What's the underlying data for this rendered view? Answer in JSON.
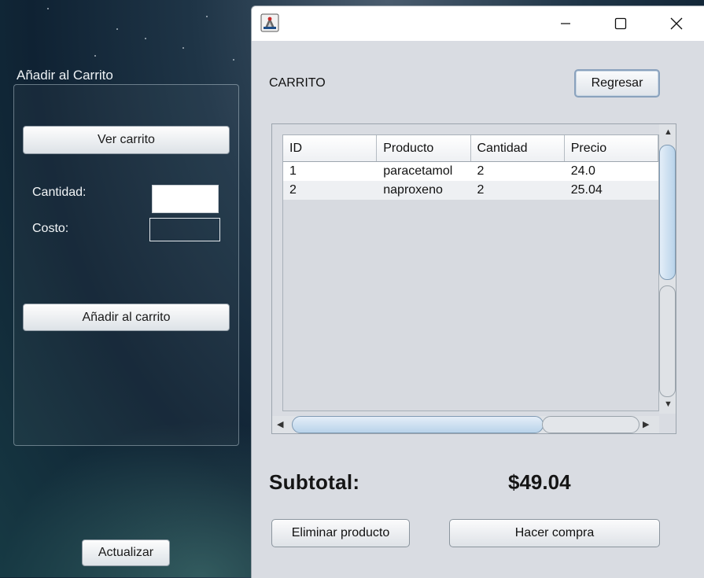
{
  "background_panel": {
    "title": "Añadir al Carrito",
    "view_cart_label": "Ver carrito",
    "quantity_label": "Cantidad:",
    "cost_label": "Costo:",
    "add_to_cart_label": "Añadir al carrito",
    "update_label": "Actualizar"
  },
  "dialog": {
    "title_bar": {
      "icon": "java-app-icon",
      "minimize": "minimize-icon",
      "maximize": "maximize-icon",
      "close": "close-icon"
    },
    "header_label": "CARRITO",
    "back_label": "Regresar",
    "table": {
      "columns": [
        "ID",
        "Producto",
        "Cantidad",
        "Precio"
      ],
      "rows": [
        [
          "1",
          "paracetamol",
          "2",
          "24.0"
        ],
        [
          "2",
          "naproxeno",
          "2",
          "25.04"
        ]
      ]
    },
    "subtotal_label": "Subtotal:",
    "subtotal_value": "$49.04",
    "delete_label": "Eliminar producto",
    "purchase_label": "Hacer compra"
  },
  "colors": {
    "accent_border": "#8aa2bd",
    "window_bg": "#d9dce2",
    "scroll_thumb": "#b9d3ea"
  }
}
